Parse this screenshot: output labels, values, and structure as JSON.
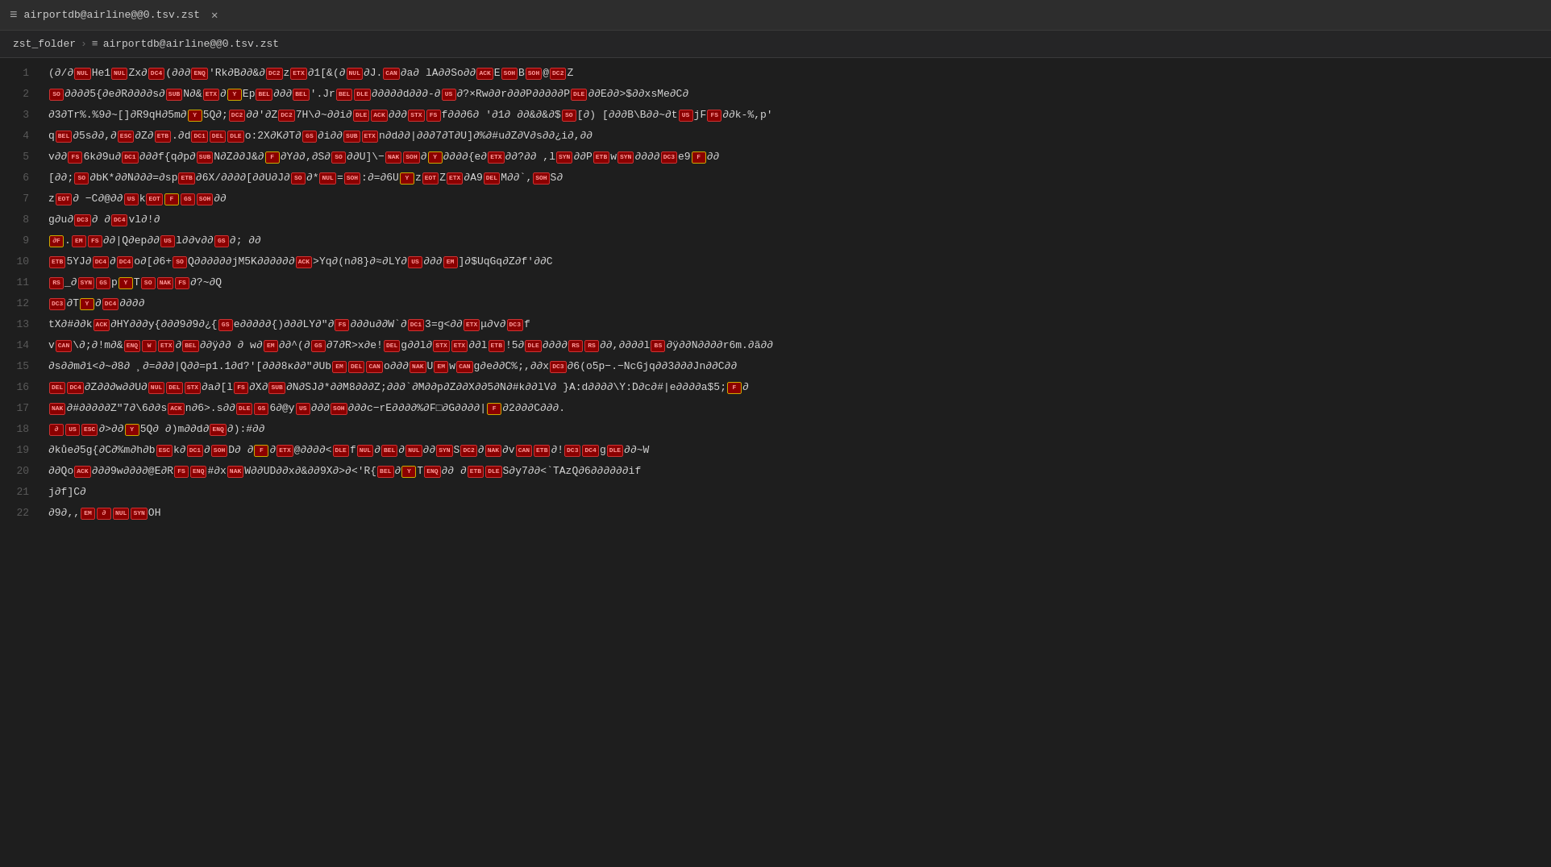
{
  "titleBar": {
    "icon": "≡",
    "filename": "airportdb@airline@@0.tsv.zst",
    "closeLabel": "✕"
  },
  "breadcrumb": {
    "folder": "zst_folder",
    "separator": "›",
    "icon": "≡",
    "file": "airportdb@airline@@0.tsv.zst"
  },
  "lines": [
    1,
    2,
    3,
    4,
    5,
    6,
    7,
    8,
    9,
    10,
    11,
    12,
    13,
    14,
    15,
    16,
    17,
    18,
    19,
    20,
    21,
    22
  ]
}
